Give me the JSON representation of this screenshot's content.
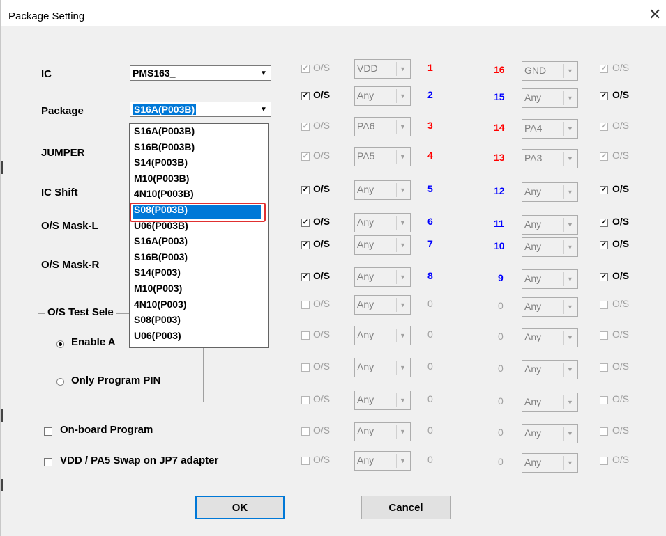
{
  "window": {
    "title": "Package Setting",
    "close": "✕"
  },
  "labels": {
    "ic": "IC",
    "package": "Package",
    "jumper": "JUMPER",
    "ic_shift": "IC Shift",
    "os_mask_l": "O/S Mask-L",
    "os_mask_r": "O/S Mask-R"
  },
  "ic_combo": {
    "value": "PMS163_"
  },
  "package_combo": {
    "value": "S16A(P003B)"
  },
  "package_options": [
    "S16A(P003B)",
    "S16B(P003B)",
    "S14(P003B)",
    "M10(P003B)",
    "4N10(P003B)",
    "S08(P003B)",
    "U06(P003B)",
    "S16A(P003)",
    "S16B(P003)",
    "S14(P003)",
    "M10(P003)",
    "4N10(P003)",
    "S08(P003)",
    "U06(P003)"
  ],
  "package_highlighted": "S08(P003B)",
  "os_test": {
    "title": "O/S Test Sele",
    "enable": "Enable A",
    "only_program": "Only Program PIN",
    "selected": "enable"
  },
  "options": {
    "onboard": {
      "label": "On-board Program",
      "checked": false
    },
    "vdd_swap": {
      "label": "VDD / PA5 Swap on JP7 adapter",
      "checked": false
    }
  },
  "os_label": "O/S",
  "left_pins": [
    {
      "os_checked": true,
      "enabled": false,
      "value": "VDD",
      "num": "1",
      "color": "red"
    },
    {
      "os_checked": true,
      "enabled": true,
      "value": "Any",
      "num": "2",
      "color": "blue"
    },
    {
      "os_checked": true,
      "enabled": false,
      "value": "PA6",
      "num": "3",
      "color": "red"
    },
    {
      "os_checked": true,
      "enabled": false,
      "value": "PA5",
      "num": "4",
      "color": "red"
    },
    {
      "os_checked": true,
      "enabled": true,
      "value": "Any",
      "num": "5",
      "color": "blue"
    },
    {
      "os_checked": true,
      "enabled": true,
      "value": "Any",
      "num": "6",
      "color": "blue"
    },
    {
      "os_checked": true,
      "enabled": true,
      "value": "Any",
      "num": "7",
      "color": "blue"
    },
    {
      "os_checked": true,
      "enabled": true,
      "value": "Any",
      "num": "8",
      "color": "blue"
    },
    {
      "os_checked": false,
      "enabled": false,
      "value": "Any",
      "num": "0",
      "color": "grey"
    },
    {
      "os_checked": false,
      "enabled": false,
      "value": "Any",
      "num": "0",
      "color": "grey"
    },
    {
      "os_checked": false,
      "enabled": false,
      "value": "Any",
      "num": "0",
      "color": "grey"
    },
    {
      "os_checked": false,
      "enabled": false,
      "value": "Any",
      "num": "0",
      "color": "grey"
    },
    {
      "os_checked": false,
      "enabled": false,
      "value": "Any",
      "num": "0",
      "color": "grey"
    },
    {
      "os_checked": false,
      "enabled": false,
      "value": "Any",
      "num": "0",
      "color": "grey"
    }
  ],
  "right_pins": [
    {
      "os_checked": true,
      "enabled": false,
      "value": "GND",
      "num": "16",
      "color": "red"
    },
    {
      "os_checked": true,
      "enabled": true,
      "value": "Any",
      "num": "15",
      "color": "blue"
    },
    {
      "os_checked": true,
      "enabled": false,
      "value": "PA4",
      "num": "14",
      "color": "red"
    },
    {
      "os_checked": true,
      "enabled": false,
      "value": "PA3",
      "num": "13",
      "color": "red"
    },
    {
      "os_checked": true,
      "enabled": true,
      "value": "Any",
      "num": "12",
      "color": "blue"
    },
    {
      "os_checked": true,
      "enabled": true,
      "value": "Any",
      "num": "11",
      "color": "blue"
    },
    {
      "os_checked": true,
      "enabled": true,
      "value": "Any",
      "num": "10",
      "color": "blue"
    },
    {
      "os_checked": true,
      "enabled": true,
      "value": "Any",
      "num": "9",
      "color": "blue"
    },
    {
      "os_checked": false,
      "enabled": false,
      "value": "Any",
      "num": "0",
      "color": "grey"
    },
    {
      "os_checked": false,
      "enabled": false,
      "value": "Any",
      "num": "0",
      "color": "grey"
    },
    {
      "os_checked": false,
      "enabled": false,
      "value": "Any",
      "num": "0",
      "color": "grey"
    },
    {
      "os_checked": false,
      "enabled": false,
      "value": "Any",
      "num": "0",
      "color": "grey"
    },
    {
      "os_checked": false,
      "enabled": false,
      "value": "Any",
      "num": "0",
      "color": "grey"
    },
    {
      "os_checked": false,
      "enabled": false,
      "value": "Any",
      "num": "0",
      "color": "grey"
    }
  ],
  "buttons": {
    "ok": "OK",
    "cancel": "Cancel"
  }
}
